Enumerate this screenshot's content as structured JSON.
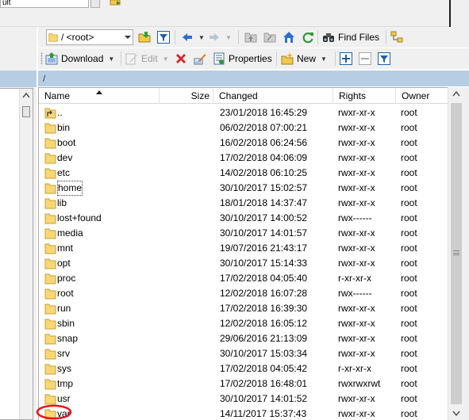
{
  "top": {
    "field_text": "ult"
  },
  "path_combo": {
    "value": "/ <root>"
  },
  "toolbar1": {
    "find_files": "Find Files"
  },
  "toolbar2": {
    "download": "Download",
    "edit": "Edit",
    "properties": "Properties",
    "new": "New"
  },
  "current_path": "/",
  "columns": {
    "name": "Name",
    "size": "Size",
    "changed": "Changed",
    "rights": "Rights",
    "owner": "Owner"
  },
  "files": [
    {
      "name": "..",
      "changed": "23/01/2018 16:45:29",
      "rights": "rwxr-xr-x",
      "owner": "root",
      "type": "parent"
    },
    {
      "name": "bin",
      "changed": "06/02/2018 07:00:21",
      "rights": "rwxr-xr-x",
      "owner": "root",
      "type": "folder"
    },
    {
      "name": "boot",
      "changed": "16/02/2018 06:24:56",
      "rights": "rwxr-xr-x",
      "owner": "root",
      "type": "folder"
    },
    {
      "name": "dev",
      "changed": "17/02/2018 04:06:09",
      "rights": "rwxr-xr-x",
      "owner": "root",
      "type": "folder"
    },
    {
      "name": "etc",
      "changed": "14/02/2018 06:10:25",
      "rights": "rwxr-xr-x",
      "owner": "root",
      "type": "folder"
    },
    {
      "name": "home",
      "changed": "30/10/2017 15:02:57",
      "rights": "rwxr-xr-x",
      "owner": "root",
      "type": "folder",
      "focused": true
    },
    {
      "name": "lib",
      "changed": "18/01/2018 14:37:47",
      "rights": "rwxr-xr-x",
      "owner": "root",
      "type": "folder"
    },
    {
      "name": "lost+found",
      "changed": "30/10/2017 14:00:52",
      "rights": "rwx------",
      "owner": "root",
      "type": "folder"
    },
    {
      "name": "media",
      "changed": "30/10/2017 14:01:57",
      "rights": "rwxr-xr-x",
      "owner": "root",
      "type": "folder"
    },
    {
      "name": "mnt",
      "changed": "19/07/2016 21:43:17",
      "rights": "rwxr-xr-x",
      "owner": "root",
      "type": "folder"
    },
    {
      "name": "opt",
      "changed": "30/10/2017 15:14:33",
      "rights": "rwxr-xr-x",
      "owner": "root",
      "type": "folder"
    },
    {
      "name": "proc",
      "changed": "17/02/2018 04:05:40",
      "rights": "r-xr-xr-x",
      "owner": "root",
      "type": "folder"
    },
    {
      "name": "root",
      "changed": "12/02/2018 16:07:28",
      "rights": "rwx------",
      "owner": "root",
      "type": "folder"
    },
    {
      "name": "run",
      "changed": "17/02/2018 16:39:30",
      "rights": "rwxr-xr-x",
      "owner": "root",
      "type": "folder"
    },
    {
      "name": "sbin",
      "changed": "12/02/2018 16:05:12",
      "rights": "rwxr-xr-x",
      "owner": "root",
      "type": "folder"
    },
    {
      "name": "snap",
      "changed": "29/06/2016 21:13:09",
      "rights": "rwxr-xr-x",
      "owner": "root",
      "type": "folder"
    },
    {
      "name": "srv",
      "changed": "30/10/2017 15:03:34",
      "rights": "rwxr-xr-x",
      "owner": "root",
      "type": "folder"
    },
    {
      "name": "sys",
      "changed": "17/02/2018 04:05:42",
      "rights": "r-xr-xr-x",
      "owner": "root",
      "type": "folder"
    },
    {
      "name": "tmp",
      "changed": "17/02/2018 16:48:01",
      "rights": "rwxrwxrwt",
      "owner": "root",
      "type": "folder"
    },
    {
      "name": "usr",
      "changed": "30/10/2017 14:01:52",
      "rights": "rwxr-xr-x",
      "owner": "root",
      "type": "folder"
    },
    {
      "name": "var",
      "changed": "14/11/2017 15:37:43",
      "rights": "rwxr-xr-x",
      "owner": "root",
      "type": "folder"
    }
  ],
  "colors": {
    "path_bar": "#b7cde4",
    "folder": "#f8d775",
    "annotation": "#e8141b"
  }
}
